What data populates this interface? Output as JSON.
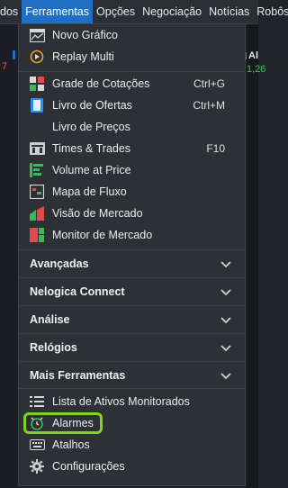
{
  "menubar": {
    "items": [
      "dos",
      "Ferramentas",
      "Opções",
      "Negociação",
      "Notícias",
      "Robôs"
    ]
  },
  "background": {
    "left_tick": "7",
    "right_tick_a": "Al",
    "right_tick_b": "1,26"
  },
  "dropdown": {
    "group1": [
      {
        "label": "Novo Gráfico",
        "icon": "chart-icon"
      },
      {
        "label": "Replay Multi",
        "icon": "replay-icon"
      }
    ],
    "group2": [
      {
        "label": "Grade de Cotações",
        "shortcut": "Ctrl+G",
        "icon": "grid-icon"
      },
      {
        "label": "Livro de Ofertas",
        "shortcut": "Ctrl+M",
        "icon": "book-icon"
      },
      {
        "label": "Livro de Preços",
        "shortcut": "",
        "icon": ""
      },
      {
        "label": "Times & Trades",
        "shortcut": "F10",
        "icon": "times-trades-icon"
      },
      {
        "label": "Volume at Price",
        "shortcut": "",
        "icon": "volume-icon"
      },
      {
        "label": "Mapa de Fluxo",
        "shortcut": "",
        "icon": "flow-map-icon"
      },
      {
        "label": "Visão de Mercado",
        "shortcut": "",
        "icon": "market-view-icon"
      },
      {
        "label": "Monitor de Mercado",
        "shortcut": "",
        "icon": "market-monitor-icon"
      }
    ],
    "sections": [
      "Avançadas",
      "Nelogica Connect",
      "Análise",
      "Relógios",
      "Mais Ferramentas"
    ],
    "group3": [
      {
        "label": "Lista de Ativos Monitorados",
        "icon": "list-icon"
      },
      {
        "label": "Alarmes",
        "icon": "alarm-icon"
      },
      {
        "label": "Atalhos",
        "icon": "keyboard-icon"
      },
      {
        "label": "Configurações",
        "icon": "gear-icon"
      }
    ]
  },
  "colors": {
    "accent": "#1f6fc4",
    "highlight": "#7ed321"
  }
}
